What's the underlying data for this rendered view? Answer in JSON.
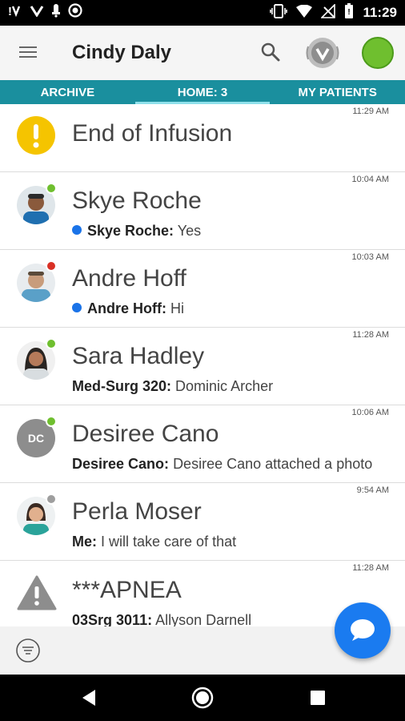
{
  "status_bar": {
    "time": "11:29",
    "left_icons": [
      "notification-icon",
      "vocera-status-icon",
      "bell-icon",
      "record-icon"
    ],
    "right_icons": [
      "vibrate-icon",
      "wifi-icon",
      "no-signal-icon",
      "battery-icon"
    ]
  },
  "app_bar": {
    "title": "Cindy Daly",
    "icons": [
      "menu-icon",
      "search-icon",
      "vocera-badge-icon",
      "presence-status"
    ]
  },
  "tabs": [
    {
      "label": "ARCHIVE",
      "active": false
    },
    {
      "label": "HOME: 3",
      "active": true
    },
    {
      "label": "MY PATIENTS",
      "active": false
    }
  ],
  "conversations": [
    {
      "time": "11:29 AM",
      "name": "End of Infusion",
      "icon": "alert-circle-icon"
    },
    {
      "time": "10:04 AM",
      "name": "Skye Roche",
      "sender": "Skye Roche:",
      "message": "Yes",
      "unread": true,
      "status_color": "#6fbf2f"
    },
    {
      "time": "10:03 AM",
      "name": "Andre Hoff",
      "sender": "Andre Hoff:",
      "message": "Hi",
      "unread": true,
      "status_color": "#d93025"
    },
    {
      "time": "11:28 AM",
      "name": "Sara Hadley",
      "sender": "Med-Surg 320:",
      "message": "Dominic Archer",
      "unread": false,
      "status_color": "#6fbf2f"
    },
    {
      "time": "10:06 AM",
      "name": "Desiree Cano",
      "initials": "DC",
      "sender": "Desiree Cano:",
      "message": "Desiree Cano attached a photo",
      "unread": false,
      "status_color": "#6fbf2f"
    },
    {
      "time": "9:54 AM",
      "name": "Perla Moser",
      "sender": "Me:",
      "message": "I will take care of that",
      "unread": false,
      "status_color": "#9e9e9e"
    },
    {
      "time": "11:28 AM",
      "name": "***APNEA",
      "sender": "03Srg 3011:",
      "message": "Allyson Darnell",
      "icon": "warning-triangle-icon"
    }
  ],
  "colors": {
    "accent_teal": "#1a8f9e",
    "fab_blue": "#1a7bf0",
    "alert_yellow": "#f5c400",
    "presence_green": "#6fbf2f"
  }
}
